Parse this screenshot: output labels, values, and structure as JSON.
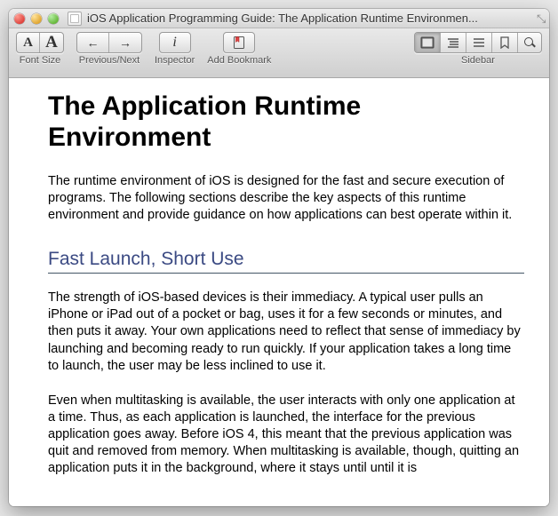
{
  "window": {
    "title": "iOS Application Programming Guide: The Application Runtime Environmen..."
  },
  "toolbar": {
    "fontSize": {
      "label": "Font Size"
    },
    "prevNext": {
      "label": "Previous/Next"
    },
    "inspector": {
      "label": "Inspector"
    },
    "addBookmark": {
      "label": "Add Bookmark"
    },
    "sidebar": {
      "label": "Sidebar"
    }
  },
  "doc": {
    "h1": "The Application Runtime Environment",
    "p1": "The runtime environment of iOS is designed for the fast and secure execution of programs. The following sections describe the key aspects of this runtime environment and provide guidance on how applications can best operate within it.",
    "h2": "Fast Launch, Short Use",
    "p2": "The strength of iOS-based devices is their immediacy. A typical user pulls an iPhone or iPad out of a pocket or bag, uses it for a few seconds or minutes, and then puts it away. Your own applications need to reflect that sense of immediacy by launching and becoming ready to run quickly. If your application takes a long time to launch, the user may be less inclined to use it.",
    "p3": "Even when multitasking is available, the user interacts with only one application at a time. Thus, as each application is launched, the interface for the previous application goes away. Before iOS 4, this meant that the previous application was quit and removed from memory. When multitasking is available, though, quitting an application puts it in the background, where it stays until until it is"
  }
}
